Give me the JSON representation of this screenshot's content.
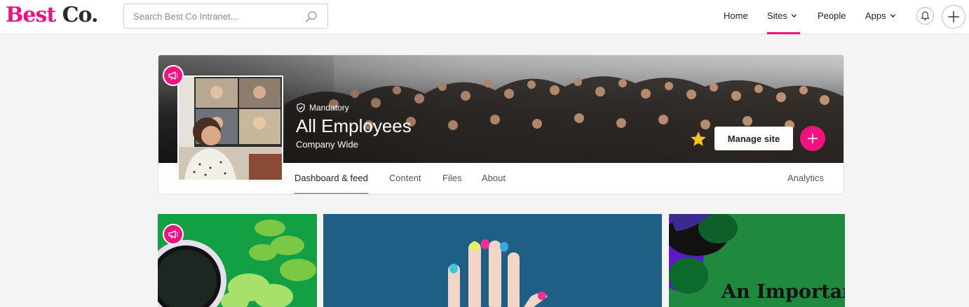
{
  "logo": {
    "part1": "Best",
    "part2": "Co."
  },
  "search": {
    "placeholder": "Search Best Co Intranet..."
  },
  "nav": {
    "home": "Home",
    "sites": "Sites",
    "people": "People",
    "apps": "Apps"
  },
  "site": {
    "tag": "Mandatory",
    "title": "All Employees",
    "subtitle": "Company Wide",
    "manage_label": "Manage site",
    "tabs": [
      "Dashboard & feed",
      "Content",
      "Files",
      "About"
    ],
    "analytics": "Analytics"
  },
  "tiles": {
    "third_headline": "An Important"
  },
  "colors": {
    "accent": "#f2127f"
  }
}
